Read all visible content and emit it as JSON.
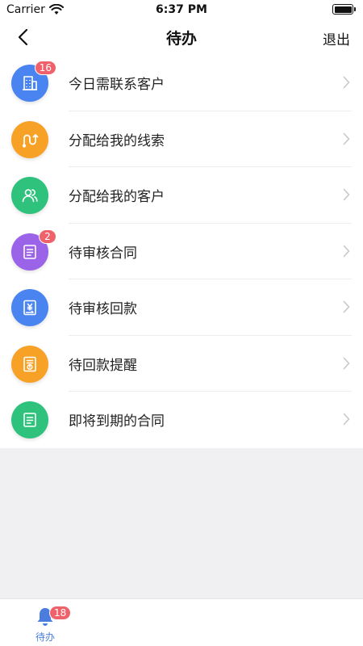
{
  "status_bar": {
    "carrier": "Carrier",
    "time": "6:37 PM"
  },
  "nav": {
    "title": "待办",
    "logout_label": "退出"
  },
  "list": [
    {
      "label": "今日需联系客户",
      "badge": "16",
      "icon": "building-icon",
      "color": "#4a84f0"
    },
    {
      "label": "分配给我的线索",
      "badge": "",
      "icon": "route-icon",
      "color": "#f7a227"
    },
    {
      "label": "分配给我的客户",
      "badge": "",
      "icon": "users-icon",
      "color": "#2ec27d"
    },
    {
      "label": "待审核合同",
      "badge": "2",
      "icon": "contract-icon",
      "color": "#9a63e8"
    },
    {
      "label": "待审核回款",
      "badge": "",
      "icon": "payment-icon",
      "color": "#4a84f0"
    },
    {
      "label": "待回款提醒",
      "badge": "",
      "icon": "reminder-icon",
      "color": "#f7a227"
    },
    {
      "label": "即将到期的合同",
      "badge": "",
      "icon": "document-icon",
      "color": "#2ec27d"
    }
  ],
  "tab_bar": {
    "tabs": [
      {
        "label": "待办",
        "badge": "18",
        "icon": "bell-icon",
        "active": true
      }
    ]
  },
  "colors": {
    "accent": "#4a7dde",
    "badge": "#f0626b"
  }
}
